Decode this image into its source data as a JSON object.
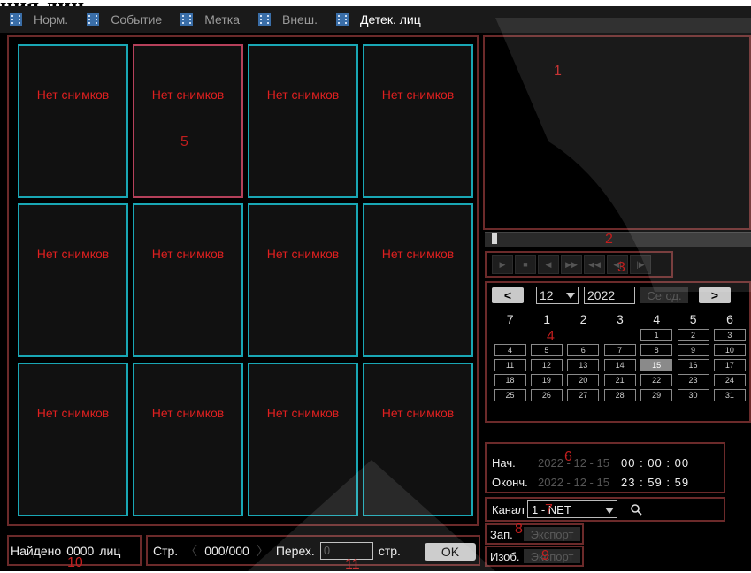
{
  "page_heading": "ция лиц",
  "tabs": [
    {
      "label": "Норм.",
      "icon": "film-icon",
      "active": false
    },
    {
      "label": "Событие",
      "icon": "film-event-icon",
      "active": false
    },
    {
      "label": "Метка",
      "icon": "film-mark-icon",
      "active": false
    },
    {
      "label": "Внеш.",
      "icon": "film-external-icon",
      "active": false
    },
    {
      "label": "Детек. лиц",
      "icon": "film-face-icon",
      "active": true
    }
  ],
  "gallery": {
    "cells": [
      "Нет снимков",
      "Нет снимков",
      "Нет снимков",
      "Нет снимков",
      "Нет снимков",
      "Нет снимков",
      "Нет снимков",
      "Нет снимков",
      "Нет снимков",
      "Нет снимков",
      "Нет снимков",
      "Нет снимков"
    ],
    "selected_index": 1
  },
  "playback": {
    "progress": 0,
    "controls": [
      "play-icon",
      "stop-icon",
      "reverse-icon",
      "fast-forward-icon",
      "slow-icon",
      "prev-frame-icon",
      "next-frame-icon"
    ]
  },
  "calendar": {
    "prev": "<",
    "next": ">",
    "month": "12",
    "year": "2022",
    "today_label": "Сегод.",
    "weekdays": [
      "7",
      "1",
      "2",
      "3",
      "4",
      "5",
      "6"
    ],
    "days": [
      "1",
      "2",
      "3",
      "4",
      "5",
      "6",
      "7",
      "8",
      "9",
      "10",
      "11",
      "12",
      "13",
      "14",
      "15",
      "16",
      "17",
      "18",
      "19",
      "20",
      "21",
      "22",
      "23",
      "24",
      "25",
      "26",
      "27",
      "28",
      "29",
      "30",
      "31"
    ],
    "selected_day": "15"
  },
  "time": {
    "start_label": "Нач.",
    "start_date": "2022 - 12 - 15",
    "start_time": "00 : 00 : 00",
    "end_label": "Оконч.",
    "end_date": "2022 - 12 - 15",
    "end_time": "23 : 59 : 59"
  },
  "channel": {
    "label": "Канал",
    "value": "1 - NET"
  },
  "export": {
    "rec_label": "Зап.",
    "img_label": "Изоб.",
    "button": "Экспорт"
  },
  "bottom": {
    "found_label": "Найдено",
    "found_count": "0000",
    "found_unit": "лиц",
    "page_label": "Стр.",
    "page_value": "000/000",
    "jump_label": "Перех.",
    "jump_value": "0",
    "page_unit": "стр.",
    "ok": "OK"
  },
  "annotations": [
    "1",
    "2",
    "3",
    "4",
    "5",
    "6",
    "7",
    "8",
    "9",
    "10",
    "11"
  ],
  "colors": {
    "accent_cell": "#19a7b5",
    "selected_cell": "#b5405a",
    "message": "#e02020",
    "annotation_box": "#6b2a2a"
  }
}
